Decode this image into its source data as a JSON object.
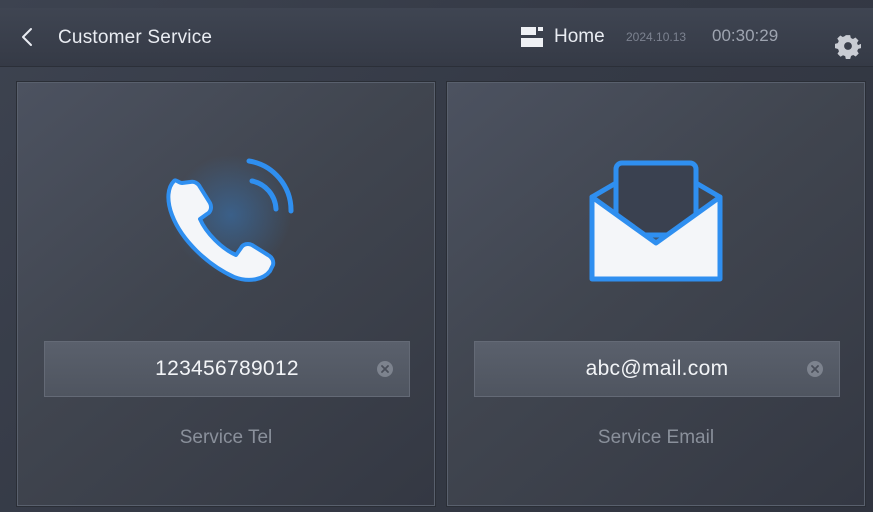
{
  "header": {
    "title": "Customer Service",
    "home_label": "Home",
    "date": "2024.10.13",
    "time": "00:30:29",
    "icons": [
      "back-chevron-icon",
      "home-icon",
      "gear-icon"
    ]
  },
  "cards": [
    {
      "icon": "phone-call-icon",
      "value": "123456789012",
      "caption": "Service Tel"
    },
    {
      "icon": "envelope-icon",
      "value": "abc@mail.com",
      "caption": "Service Email"
    }
  ],
  "colors": {
    "accent": "#2f8ff0",
    "background": "#353a46",
    "text": "#e9ecf2",
    "muted": "#8a909b"
  }
}
